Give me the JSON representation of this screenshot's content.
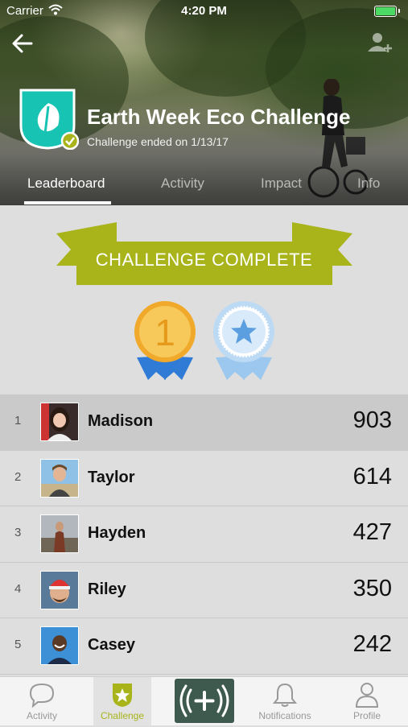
{
  "status_bar": {
    "carrier": "Carrier",
    "time": "4:20 PM"
  },
  "header": {
    "title": "Earth Week Eco Challenge",
    "subtitle": "Challenge ended on 1/13/17",
    "tabs": [
      {
        "label": "Leaderboard",
        "active": true
      },
      {
        "label": "Activity"
      },
      {
        "label": "Impact"
      },
      {
        "label": "Info"
      }
    ]
  },
  "banner": {
    "text": "CHALLENGE COMPLETE",
    "color": "#a8b41a",
    "dark_color": "#7d8a12"
  },
  "medals": [
    {
      "icon": "gold-medal-1-icon",
      "text": "1"
    },
    {
      "icon": "blue-star-medal-icon"
    }
  ],
  "leaderboard": [
    {
      "rank": "1",
      "name": "Madison",
      "score": "903"
    },
    {
      "rank": "2",
      "name": "Taylor",
      "score": "614"
    },
    {
      "rank": "3",
      "name": "Hayden",
      "score": "427"
    },
    {
      "rank": "4",
      "name": "Riley",
      "score": "350"
    },
    {
      "rank": "5",
      "name": "Casey",
      "score": "242"
    }
  ],
  "bottom_nav": {
    "items": [
      {
        "label": "Activity",
        "icon": "chat-bubble-icon"
      },
      {
        "label": "Challenge",
        "icon": "star-badge-icon",
        "active": true
      },
      {
        "label": "",
        "icon": "plus-broadcast-icon"
      },
      {
        "label": "Notifications",
        "icon": "bell-icon"
      },
      {
        "label": "Profile",
        "icon": "person-icon"
      }
    ]
  },
  "colors": {
    "accent": "#a8b41a",
    "badge_teal": "#17c3b2",
    "plus_button": "#3e5a4e"
  }
}
